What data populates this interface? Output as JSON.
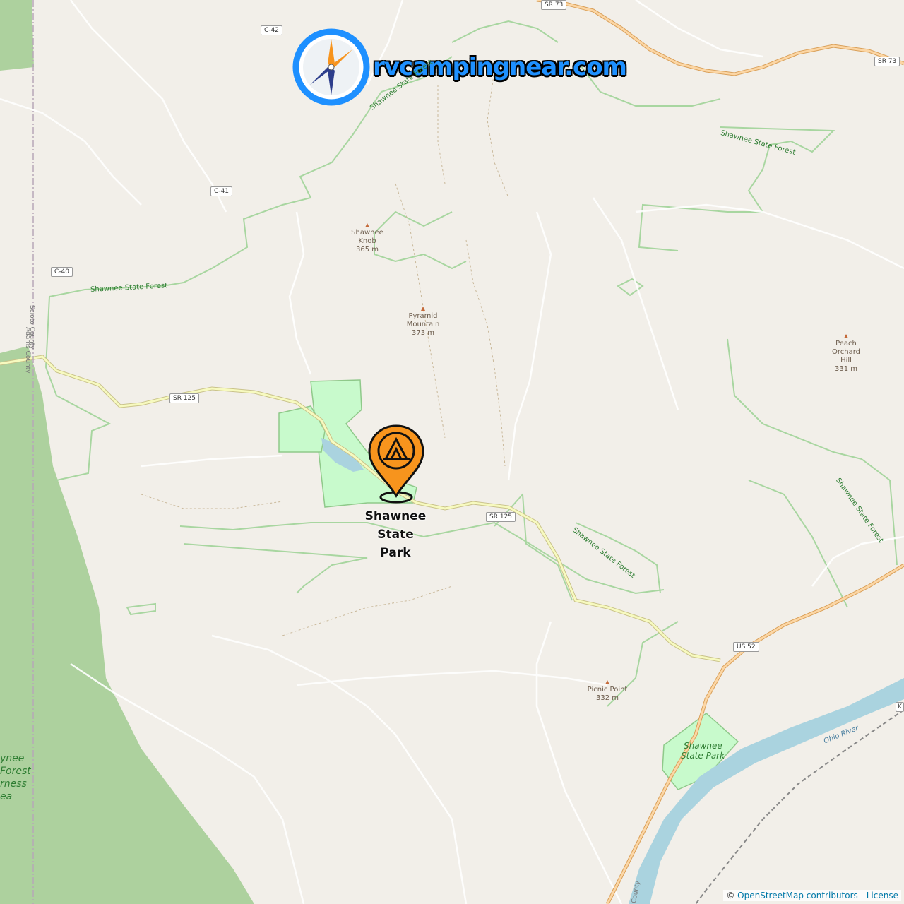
{
  "logo": {
    "text": "rvcampingnear.com",
    "icon": "compass-icon"
  },
  "marker": {
    "icon": "tent-pin-icon",
    "label_lines": [
      "Shawnee",
      "State",
      "Park"
    ],
    "color": "#f7941d"
  },
  "route_shields": [
    {
      "id": "sr73-top",
      "text": "SR 73"
    },
    {
      "id": "sr73-right",
      "text": "SR 73"
    },
    {
      "id": "c42",
      "text": "C-42"
    },
    {
      "id": "c41",
      "text": "C-41"
    },
    {
      "id": "c40",
      "text": "C-40"
    },
    {
      "id": "sr125-left",
      "text": "SR 125"
    },
    {
      "id": "sr125-mid",
      "text": "SR 125"
    },
    {
      "id": "us52",
      "text": "US 52"
    }
  ],
  "peaks": [
    {
      "id": "shawnee-knob",
      "lines": [
        "Shawnee",
        "Knob",
        "365 m"
      ]
    },
    {
      "id": "pyramid-mountain",
      "lines": [
        "Pyramid",
        "Mountain",
        "373 m"
      ]
    },
    {
      "id": "peach-orchard-hill",
      "lines": [
        "Peach",
        "Orchard",
        "Hill",
        "331 m"
      ]
    },
    {
      "id": "picnic-point",
      "lines": [
        "Picnic Point",
        "332 m"
      ]
    }
  ],
  "area_labels": {
    "forest_top": "Shawnee State Forest",
    "forest_left": "Shawnee State Forest",
    "forest_right_top": "Shawnee State Forest",
    "forest_mid": "Shawnee State Forest",
    "forest_far_right": "Shawnee State Forest",
    "park_bottom_line1": "Shawnee",
    "park_bottom_line2": "State Park",
    "wilderness_line1": "ynee",
    "wilderness_line2": "Forest",
    "wilderness_line3": "rness",
    "wilderness_line4": "ea",
    "river": "Ohio River",
    "county_scioto": "Scioto County",
    "county_adams": "Adams County",
    "county_bottom": "County",
    "edge_k": "K"
  },
  "attribution": {
    "prefix": "© ",
    "osm": "OpenStreetMap contributors",
    "sep": " - ",
    "license": "License"
  },
  "colors": {
    "land": "#f2efe9",
    "forest": "#add19e",
    "park": "#c8facc",
    "primary_road": "#fcd6a4",
    "secondary_road": "#f7fabf",
    "water": "#aad3df",
    "boundary": "#8fc98a",
    "accent": "#f7941d"
  }
}
